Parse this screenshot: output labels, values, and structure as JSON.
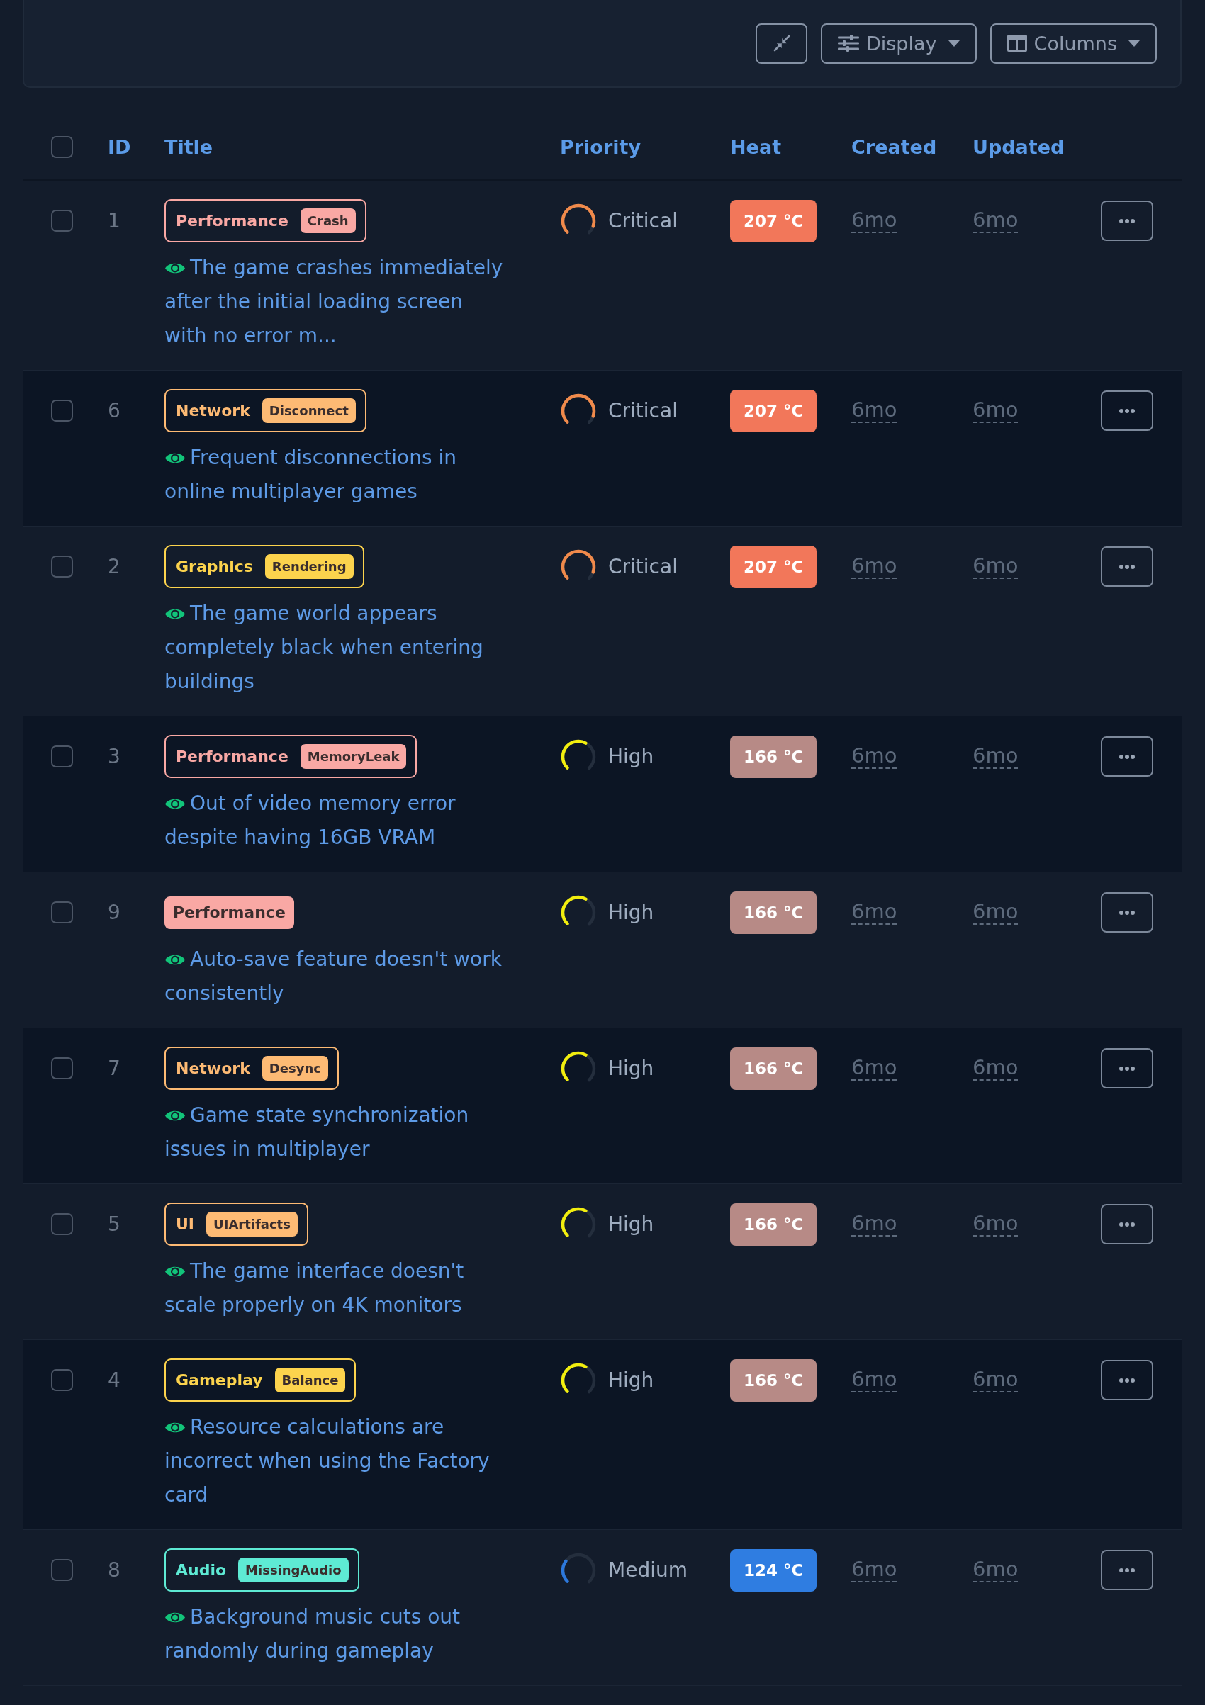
{
  "toolbar": {
    "display_button": {
      "label": "Display"
    },
    "columns_button": {
      "label": "Columns"
    }
  },
  "table": {
    "select_all": {
      "checked": false
    },
    "columns": [
      "ID",
      "Title",
      "Priority",
      "Heat",
      "Created",
      "Updated"
    ],
    "rows": [
      {
        "checked": false,
        "id": "1",
        "tag": {
          "label": "Performance",
          "sub": "Crash",
          "color": "#f9a8a4"
        },
        "title": "The game crashes immediately after the initial loading screen with no error m...",
        "priority": {
          "label": "Critical",
          "level": 0.9,
          "color": "#f08a4b"
        },
        "heat": {
          "label": "207 °C",
          "color": "#f2775a"
        },
        "created": "6mo",
        "updated": "6mo"
      },
      {
        "checked": false,
        "id": "6",
        "tag": {
          "label": "Network",
          "sub": "Disconnect",
          "color": "#fdba74"
        },
        "title": "Frequent disconnections in online multiplayer games",
        "priority": {
          "label": "Critical",
          "level": 0.9,
          "color": "#f08a4b"
        },
        "heat": {
          "label": "207 °C",
          "color": "#f2775a"
        },
        "created": "6mo",
        "updated": "6mo"
      },
      {
        "checked": false,
        "id": "2",
        "tag": {
          "label": "Graphics",
          "sub": "Rendering",
          "color": "#fcd34d"
        },
        "title": "The game world appears completely black when entering buildings",
        "priority": {
          "label": "Critical",
          "level": 0.9,
          "color": "#f08a4b"
        },
        "heat": {
          "label": "207 °C",
          "color": "#f2775a"
        },
        "created": "6mo",
        "updated": "6mo"
      },
      {
        "checked": false,
        "id": "3",
        "tag": {
          "label": "Performance",
          "sub": "MemoryLeak",
          "color": "#f9a8a4"
        },
        "title": "Out of video memory error despite having 16GB VRAM",
        "priority": {
          "label": "High",
          "level": 0.6,
          "color": "#f2ee0e"
        },
        "heat": {
          "label": "166 °C",
          "color": "#b78a86"
        },
        "created": "6mo",
        "updated": "6mo"
      },
      {
        "checked": false,
        "id": "9",
        "tag": {
          "label": "Performance",
          "color": "#f9a8a4"
        },
        "title": "Auto-save feature doesn't work consistently",
        "priority": {
          "label": "High",
          "level": 0.6,
          "color": "#f2ee0e"
        },
        "heat": {
          "label": "166 °C",
          "color": "#b78a86"
        },
        "created": "6mo",
        "updated": "6mo"
      },
      {
        "checked": false,
        "id": "7",
        "tag": {
          "label": "Network",
          "sub": "Desync",
          "color": "#fdba74"
        },
        "title": "Game state synchronization issues in multiplayer",
        "priority": {
          "label": "High",
          "level": 0.6,
          "color": "#f2ee0e"
        },
        "heat": {
          "label": "166 °C",
          "color": "#b78a86"
        },
        "created": "6mo",
        "updated": "6mo"
      },
      {
        "checked": false,
        "id": "5",
        "tag": {
          "label": "UI",
          "sub": "UIArtifacts",
          "color": "#fdba74"
        },
        "title": "The game interface doesn't scale properly on 4K monitors",
        "priority": {
          "label": "High",
          "level": 0.6,
          "color": "#f2ee0e"
        },
        "heat": {
          "label": "166 °C",
          "color": "#b78a86"
        },
        "created": "6mo",
        "updated": "6mo"
      },
      {
        "checked": false,
        "id": "4",
        "tag": {
          "label": "Gameplay",
          "sub": "Balance",
          "color": "#fcd34d"
        },
        "title": "Resource calculations are incorrect when using the Factory card",
        "priority": {
          "label": "High",
          "level": 0.6,
          "color": "#f2ee0e"
        },
        "heat": {
          "label": "166 °C",
          "color": "#b78a86"
        },
        "created": "6mo",
        "updated": "6mo"
      },
      {
        "checked": false,
        "id": "8",
        "tag": {
          "label": "Audio",
          "sub": "MissingAudio",
          "color": "#5eead4"
        },
        "title": "Background music cuts out randomly during gameplay",
        "priority": {
          "label": "Medium",
          "level": 0.3,
          "color": "#2c78dc"
        },
        "heat": {
          "label": "124 °C",
          "color": "#2f7de1"
        },
        "created": "6mo",
        "updated": "6mo"
      }
    ]
  }
}
